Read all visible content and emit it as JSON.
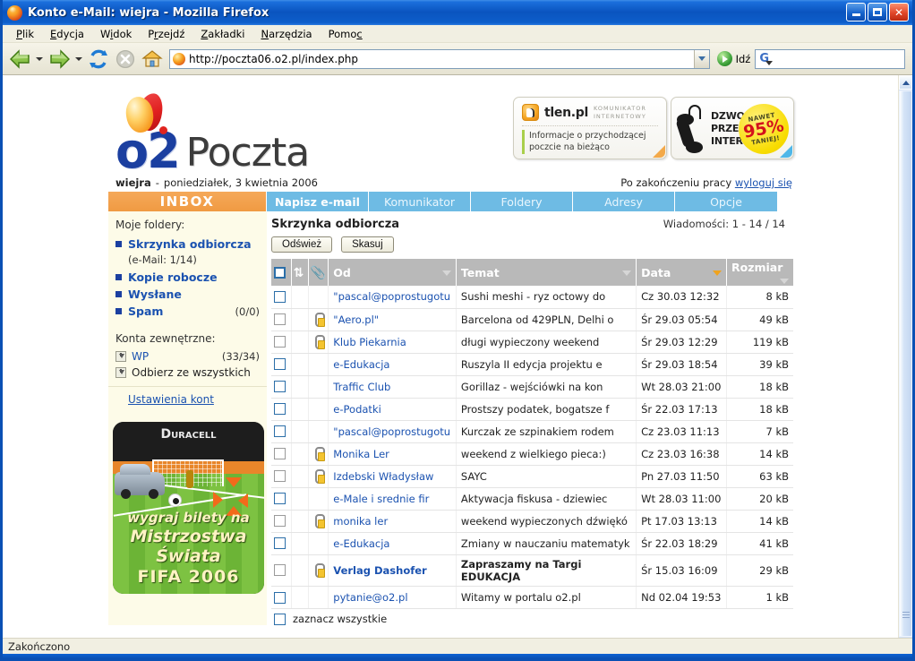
{
  "window": {
    "title": "Konto e-Mail: wiejra - Mozilla Firefox",
    "minimize_label": "_",
    "maximize_label": "□",
    "close_label": "✕"
  },
  "menubar": [
    {
      "label": "Plik"
    },
    {
      "label": "Edycja"
    },
    {
      "label": "Widok"
    },
    {
      "label": "Przejdź"
    },
    {
      "label": "Zakładki"
    },
    {
      "label": "Narzędzia"
    },
    {
      "label": "Pomoc"
    }
  ],
  "toolbar": {
    "back_icon": "back-arrow-icon",
    "forward_icon": "forward-arrow-icon",
    "reload_icon": "reload-icon",
    "stop_icon": "stop-icon",
    "home_icon": "home-icon",
    "url": "http://poczta06.o2.pl/index.php",
    "go_label": "Idź",
    "search_placeholder": "",
    "search_value": "",
    "search_engine_icon": "google-g-icon"
  },
  "page": {
    "logo": {
      "mark": "o2",
      "word": "Poczta"
    },
    "banner_tlen": {
      "name": "tlen.pl",
      "subtitle_line1": "KOMUNIKATOR",
      "subtitle_line2": "INTERNETOWY",
      "text_line1": "Informacje o przychodzącej",
      "text_line2": "poczcie na bieżąco"
    },
    "banner_call": {
      "line1": "DZWOŃ",
      "line2": "PRZEZ",
      "line3": "INTERNET",
      "badge_top": "NAWET",
      "badge_main": "95%",
      "badge_bottom": "TANIEJ!"
    },
    "userline": {
      "username": "wiejra",
      "separator": "-",
      "date": "poniedziałek, 3 kwietnia 2006",
      "logout_prefix": "Po zakończeniu pracy",
      "logout_link": "wyloguj się"
    },
    "tabs": [
      {
        "label": "INBOX",
        "active": true
      },
      {
        "label": "Napisz e-mail",
        "bold": true
      },
      {
        "label": "Komunikator"
      },
      {
        "label": "Foldery"
      },
      {
        "label": "Adresy"
      },
      {
        "label": "Opcje"
      }
    ],
    "sidebar": {
      "title": "Moje foldery:",
      "folders": [
        {
          "name": "Skrzynka odbiorcza",
          "count": "",
          "subline": "(e-Mail: 1/14)"
        },
        {
          "name": "Kopie robocze",
          "count": "",
          "subline": ""
        },
        {
          "name": "Wysłane",
          "count": "",
          "subline": ""
        },
        {
          "name": "Spam",
          "count": "(0/0)",
          "subline": ""
        }
      ],
      "external_title": "Konta zewnętrzne:",
      "external": [
        {
          "name": "WP",
          "count": "(33/34)"
        },
        {
          "name": "Odbierz ze wszystkich",
          "count": ""
        }
      ],
      "settings_link": "Ustawienia kont",
      "ad": {
        "brand_d": "D",
        "brand_rest": "URACELL",
        "line1": "wygraj bilety na",
        "line2": "Mistrzostwa",
        "line3": "Świata",
        "line4": "FIFA 2006"
      }
    },
    "mail": {
      "heading": "Skrzynka odbiorcza",
      "count_label": "Wiadomości: 1 - 14 / 14",
      "refresh_button": "Odśwież",
      "delete_button": "Skasuj",
      "columns": {
        "select_all_icon": "checkbox-icon",
        "sync_icon": "sync-arrows-icon",
        "attachment_icon": "paperclip-icon",
        "from": "Od",
        "subject": "Temat",
        "date": "Data",
        "size": "Rozmiar"
      },
      "sorted_column": "Data",
      "rows": [
        {
          "from": "\"pascal@poprostugotu",
          "subject": "Sushi meshi - ryz octowy do",
          "date": "Cz 30.03 12:32",
          "size": "8 kB",
          "attachment": false,
          "unread": false,
          "checked": false
        },
        {
          "from": "\"Aero.pl\"",
          "subject": "Barcelona od 429PLN, Delhi o",
          "date": "Śr 29.03 05:54",
          "size": "49 kB",
          "attachment": true,
          "unread": false,
          "checked": false
        },
        {
          "from": "Klub Piekarnia",
          "subject": "długi wypieczony weekend",
          "date": "Śr 29.03 12:29",
          "size": "119 kB",
          "attachment": true,
          "unread": false,
          "checked": false
        },
        {
          "from": "e-Edukacja",
          "subject": "Ruszyla II edycja projektu e",
          "date": "Śr 29.03 18:54",
          "size": "39 kB",
          "attachment": false,
          "unread": false,
          "checked": false
        },
        {
          "from": "Traffic Club",
          "subject": "Gorillaz - wejściówki na kon",
          "date": "Wt 28.03 21:00",
          "size": "18 kB",
          "attachment": false,
          "unread": false,
          "checked": false
        },
        {
          "from": "e-Podatki",
          "subject": "Prostszy podatek, bogatsze f",
          "date": "Śr 22.03 17:13",
          "size": "18 kB",
          "attachment": false,
          "unread": false,
          "checked": false
        },
        {
          "from": "\"pascal@poprostugotu",
          "subject": "Kurczak ze szpinakiem rodem",
          "date": "Cz 23.03 11:13",
          "size": "7 kB",
          "attachment": false,
          "unread": false,
          "checked": false
        },
        {
          "from": "Monika Ler",
          "subject": "weekend z wielkiego pieca:)",
          "date": "Cz 23.03 16:38",
          "size": "14 kB",
          "attachment": true,
          "unread": false,
          "checked": false
        },
        {
          "from": "Izdebski Władysław",
          "subject": "SAYC",
          "date": "Pn 27.03 11:50",
          "size": "63 kB",
          "attachment": true,
          "unread": false,
          "checked": false
        },
        {
          "from": "e-Male i srednie fir",
          "subject": "Aktywacja fiskusa - dziewiec",
          "date": "Wt 28.03 11:00",
          "size": "20 kB",
          "attachment": false,
          "unread": false,
          "checked": false
        },
        {
          "from": "monika ler",
          "subject": "weekend wypieczonych dźwiękó",
          "date": "Pt 17.03 13:13",
          "size": "14 kB",
          "attachment": true,
          "unread": false,
          "checked": false
        },
        {
          "from": "e-Edukacja",
          "subject": "Zmiany w nauczaniu matematyk",
          "date": "Śr 22.03 18:29",
          "size": "41 kB",
          "attachment": false,
          "unread": false,
          "checked": false
        },
        {
          "from": "Verlag Dashofer",
          "subject": "Zapraszamy na Targi EDUKACJA",
          "date": "Śr 15.03 16:09",
          "size": "29 kB",
          "attachment": true,
          "unread": true,
          "checked": false
        },
        {
          "from": "pytanie@o2.pl",
          "subject": "Witamy w portalu o2.pl",
          "date": "Nd 02.04 19:53",
          "size": "1 kB",
          "attachment": false,
          "unread": false,
          "checked": false
        }
      ],
      "select_all_label": "zaznacz wszystkie"
    }
  },
  "statusbar": {
    "text": "Zakończono"
  },
  "colors": {
    "titlebar_blue": "#0a54bf",
    "tab_blue": "#6ebbe4",
    "inbox_orange": "#f09a42",
    "link_blue": "#1b52b0",
    "sidebar_cream": "#fdfbe8",
    "header_grey": "#b9b9b9",
    "sort_arrow_orange": "#f0a31e"
  }
}
